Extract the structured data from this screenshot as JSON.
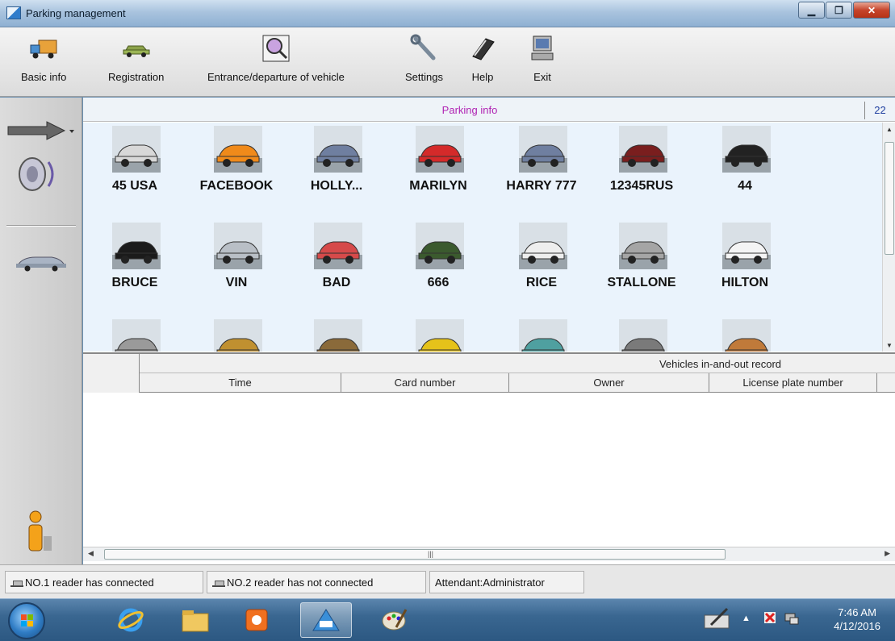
{
  "window": {
    "title": "Parking management",
    "minimize_icon": "minimize-icon",
    "maximize_icon": "maximize-icon",
    "close_icon": "close-icon"
  },
  "toolbar": {
    "items": [
      {
        "label": "Basic info",
        "icon": "truck-icon"
      },
      {
        "label": "Registration",
        "icon": "car-icon"
      },
      {
        "label": "Entrance/departure of vehicle",
        "icon": "magnifier-icon"
      },
      {
        "label": "Settings",
        "icon": "wrench-icon"
      },
      {
        "label": "Help",
        "icon": "book-icon"
      },
      {
        "label": "Exit",
        "icon": "computer-icon"
      }
    ]
  },
  "sidebar": {
    "icons": [
      "arrow-dropdown-icon",
      "speaker-icon",
      "car-icon",
      "info-person-icon"
    ]
  },
  "parking": {
    "title": "Parking info",
    "count": "22",
    "vehicles": [
      {
        "label": "45 USA",
        "color": "#d8d8d8"
      },
      {
        "label": "FACEBOOK",
        "color": "#f08a1a"
      },
      {
        "label": "HOLLY...",
        "color": "#6f7fa0"
      },
      {
        "label": "MARILYN",
        "color": "#d42a2a"
      },
      {
        "label": "HARRY 777",
        "color": "#6f7fa0"
      },
      {
        "label": "12345RUS",
        "color": "#7a1e1e"
      },
      {
        "label": "44",
        "color": "#222222"
      },
      {
        "label": "BRUCE",
        "color": "#1b1b1b"
      },
      {
        "label": "VIN",
        "color": "#b9bfc6"
      },
      {
        "label": "BAD",
        "color": "#d64a4a"
      },
      {
        "label": "666",
        "color": "#3b5a2e"
      },
      {
        "label": "RICE",
        "color": "#eeeeee"
      },
      {
        "label": "STALLONE",
        "color": "#a5a5a5"
      },
      {
        "label": "HILTON",
        "color": "#f4f4f4"
      },
      {
        "label": "",
        "color": "#9a9a9a"
      },
      {
        "label": "",
        "color": "#c09030"
      },
      {
        "label": "",
        "color": "#8a6a3a"
      },
      {
        "label": "",
        "color": "#e5c21a"
      },
      {
        "label": "",
        "color": "#4fa0a0"
      },
      {
        "label": "",
        "color": "#7a7a7a"
      },
      {
        "label": "",
        "color": "#c07a3a"
      }
    ]
  },
  "records": {
    "title": "Vehicles in-and-out record",
    "columns": [
      "Time",
      "Card number",
      "Owner",
      "License plate number"
    ]
  },
  "statusbar": {
    "reader1": "NO.1 reader has connected",
    "reader2": "NO.2 reader has not connected",
    "attendant": "Attendant:Administrator"
  },
  "taskbar": {
    "pinned": [
      "start-orb-icon",
      "internet-explorer-icon",
      "file-explorer-icon",
      "media-player-icon",
      "parking-app-icon",
      "paint-icon"
    ],
    "clock_time": "7:46 AM",
    "clock_date": "4/12/2016"
  }
}
